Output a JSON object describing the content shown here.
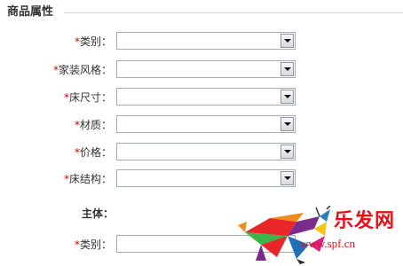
{
  "section": {
    "title": "商品属性"
  },
  "required_mark": "*",
  "fields": [
    {
      "label": "类别：",
      "value": ""
    },
    {
      "label": "家装风格：",
      "value": ""
    },
    {
      "label": "床尺寸：",
      "value": ""
    },
    {
      "label": "材质：",
      "value": ""
    },
    {
      "label": "价格：",
      "value": ""
    },
    {
      "label": "床结构：",
      "value": ""
    }
  ],
  "subsection": {
    "title": "主体：",
    "fields": [
      {
        "label": "类别：",
        "value": ""
      }
    ]
  },
  "watermark": {
    "name": "乐发网",
    "url": "www.spf.cn",
    "icon": "colorful-bull-logo"
  },
  "colors": {
    "required": "#d40000",
    "border": "#a5acb5",
    "watermark": "#e0141a"
  }
}
